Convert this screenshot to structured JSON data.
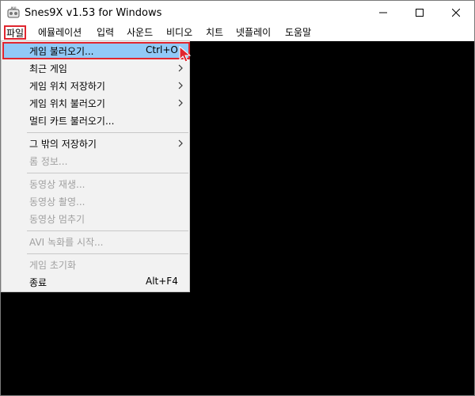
{
  "window": {
    "title": "Snes9X v1.53 for Windows",
    "app_icon_label": "AVI"
  },
  "menubar": {
    "items": [
      {
        "label": "파일",
        "active": true
      },
      {
        "label": "에뮬레이션"
      },
      {
        "label": "입력"
      },
      {
        "label": "사운드"
      },
      {
        "label": "비디오"
      },
      {
        "label": "치트"
      },
      {
        "label": "넷플레이"
      },
      {
        "label": "도움말"
      }
    ]
  },
  "file_menu": {
    "items": [
      {
        "label": "게임 불러오기...",
        "shortcut": "Ctrl+O",
        "highlighted": true
      },
      {
        "label": "최근 게임",
        "submenu": true
      },
      {
        "label": "게임 위치 저장하기",
        "submenu": true
      },
      {
        "label": "게임 위치 불러오기",
        "submenu": true
      },
      {
        "label": "멀티 카트 불러오기..."
      },
      {
        "label": "그 밖의 저장하기",
        "submenu": true
      },
      {
        "label": "롬 정보...",
        "disabled": true
      },
      {
        "label": "동영상 재생...",
        "disabled": true
      },
      {
        "label": "동영상 촬영...",
        "disabled": true
      },
      {
        "label": "동영상 멈추기",
        "disabled": true
      },
      {
        "label": "AVI 녹화를 시작...",
        "disabled": true
      },
      {
        "label": "게임 초기화",
        "disabled": true
      },
      {
        "label": "종료",
        "shortcut": "Alt+F4"
      }
    ]
  },
  "colors": {
    "highlight": "#91c9f7",
    "focus_border": "#e0262f",
    "menu_bg": "#f2f2f2",
    "client_bg": "#000000",
    "disabled_text": "#a0a0a0"
  },
  "icons": {
    "app": "snes9x-app-icon",
    "minimize": "minimize-icon",
    "maximize": "maximize-icon",
    "close": "close-icon",
    "submenu": "chevron-right-icon",
    "cursor": "mouse-pointer-icon"
  }
}
